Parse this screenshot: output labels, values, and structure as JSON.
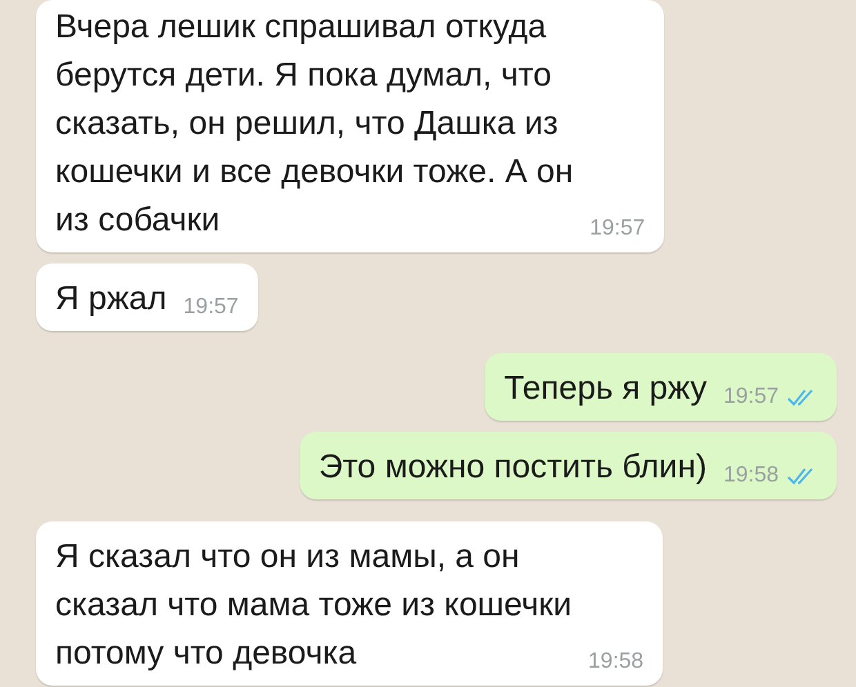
{
  "messages": [
    {
      "kind": "incoming",
      "text": "Вчера лешик спрашивал откуда\nберутся дети. Я пока думал, что\nсказать, он решил, что Дашка из\nкошечки и все девочки тоже. А он\nиз собачки",
      "time": "19:57"
    },
    {
      "kind": "incoming",
      "text": "Я ржал",
      "time": "19:57"
    },
    {
      "kind": "outgoing",
      "text": "Теперь я ржу",
      "time": "19:57",
      "read": true
    },
    {
      "kind": "outgoing",
      "text": "Это можно постить блин)",
      "time": "19:58",
      "read": true
    },
    {
      "kind": "incoming",
      "text": "Я сказал что он из мамы, а он\nсказал что мама тоже из кошечки\nпотому что девочка",
      "time": "19:58"
    }
  ]
}
